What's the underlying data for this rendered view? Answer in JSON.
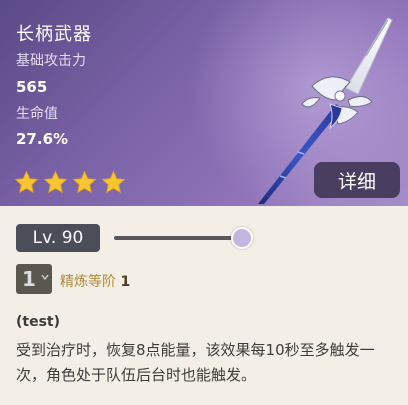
{
  "weapon": {
    "type": "长柄武器",
    "stats": [
      {
        "label": "基础攻击力",
        "value": "565"
      },
      {
        "label": "生命值",
        "value": "27.6%"
      }
    ],
    "rarity_stars": 4,
    "detail_label": "详细"
  },
  "level": {
    "label": "Lv. 90",
    "slider_fraction": 1.0
  },
  "refinement": {
    "rank": "1",
    "label": "精炼等阶",
    "level": "1"
  },
  "passive": {
    "name": "(test)",
    "description": "受到治疗时，恢复8点能量，该效果每10秒至多触发一次，角色处于队伍后台时也能触发。"
  },
  "colors": {
    "header_purple": "#7b63a8",
    "star_gold": "#f7c531",
    "refine_gold": "#b08a3a"
  }
}
